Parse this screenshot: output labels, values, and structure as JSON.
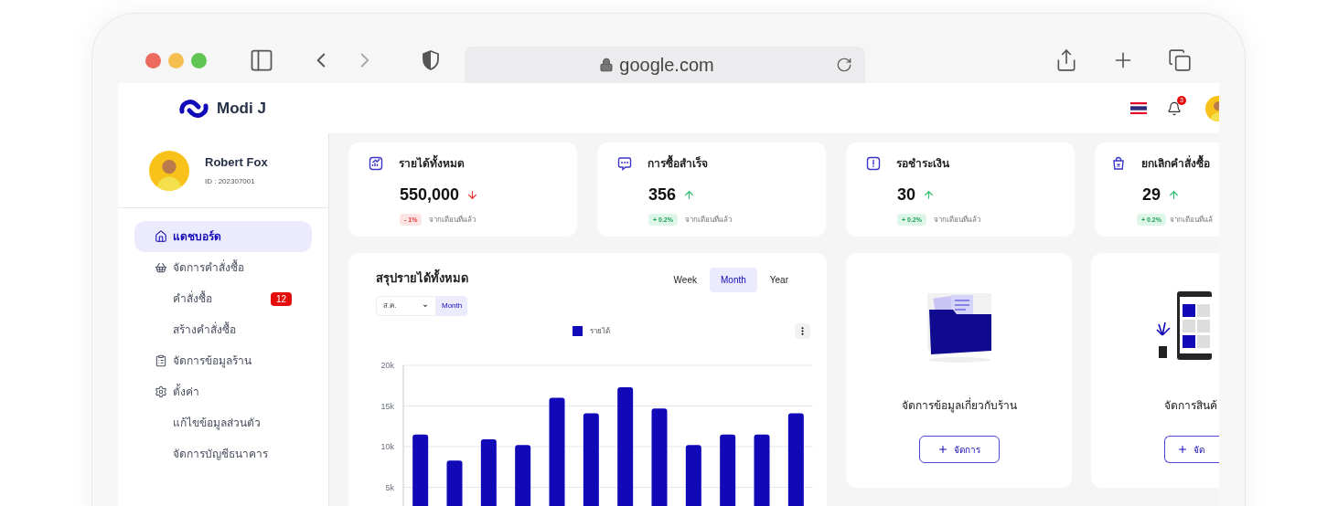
{
  "browser": {
    "url": "google.com"
  },
  "header": {
    "brand": "Modi J",
    "notification_count": "3"
  },
  "profile": {
    "name": "Robert Fox",
    "id": "ID : 202307001"
  },
  "sidebar": {
    "items": [
      {
        "label": "แดชบอร์ด",
        "selected": true
      },
      {
        "label": "จัดการคำสั่งซื้อ",
        "selected": false,
        "children": [
          {
            "label": "คำสั่งซื้อ",
            "selected": false,
            "badge": "12"
          },
          {
            "label": "สร้างคำสั่งซื้อ",
            "selected": false
          }
        ]
      },
      {
        "label": "จัดการข้อมูลร้าน",
        "selected": false
      },
      {
        "label": "ตั้งค่า",
        "selected": false,
        "children": [
          {
            "label": "แก้ไขข้อมูลส่วนตัว",
            "selected": false
          },
          {
            "label": "จัดการบัญชีธนาคาร",
            "selected": false
          }
        ]
      }
    ]
  },
  "stats": [
    {
      "title": "รายได้ทั้งหมด",
      "value": "550,000",
      "rising": false,
      "change": "- 1%",
      "note": "จากเดือนที่แล้ว"
    },
    {
      "title": "การซื้อสำเร็จ",
      "value": "356",
      "rising": true,
      "change": "+ 0.2%",
      "note": "จากเดือนที่แล้ว"
    },
    {
      "title": "รอชำระเงิน",
      "value": "30",
      "rising": true,
      "change": "+ 0.2%",
      "note": "จากเดือนที่แล้ว"
    },
    {
      "title": "ยกเลิกคำสั่งซื้อ",
      "value": "29",
      "rising": true,
      "change": "+ 0.2%",
      "note": "จากเดือนที่แล้"
    }
  ],
  "revenue": {
    "title": "สรุปรายได้ทั้งหมด",
    "tabs": [
      {
        "label": "Week",
        "selected": false
      },
      {
        "label": "Month",
        "selected": true
      },
      {
        "label": "Year",
        "selected": false
      }
    ],
    "filter": {
      "value": "ส.ค.",
      "button": "Month"
    },
    "chart_data": {
      "type": "bar",
      "grid": true,
      "ylim": [
        0,
        20000
      ],
      "yticks": [
        {
          "value": 5000,
          "label": "5k"
        },
        {
          "value": 10000,
          "label": "10k"
        },
        {
          "value": 15000,
          "label": "15k"
        },
        {
          "value": 20000,
          "label": "20k"
        }
      ],
      "series": [
        {
          "name": "รายได้",
          "color": "#1109b8",
          "values": [
            11500,
            8300,
            10900,
            10200,
            16000,
            14100,
            17300,
            14700,
            10200,
            11500,
            11500,
            14100
          ]
        }
      ]
    }
  },
  "action_cards": [
    {
      "title": "จัดการข้อมูลเกี่ยวกับร้าน",
      "button": "จัดการ"
    },
    {
      "title": "จัดการสินค้",
      "button": "จัด"
    }
  ]
}
